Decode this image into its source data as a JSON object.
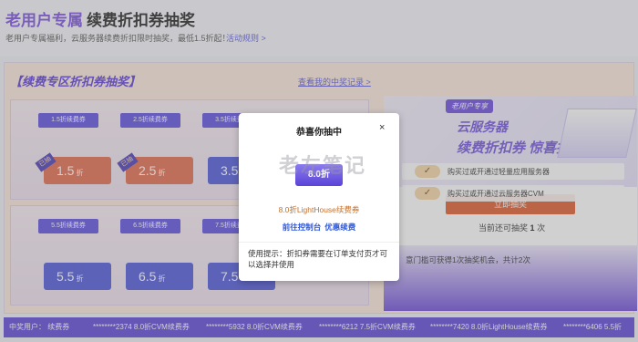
{
  "header": {
    "title_accent": "老用户专属",
    "title_main": "续费折扣券抽奖",
    "subtitle": "老用户专属福利，云服务器续费折扣限时抽奖，最低1.5折起！",
    "rules_link": "活动规则 >"
  },
  "left_panel": {
    "title": "【续费专区折扣券抽奖】",
    "records_link": "查看我的中奖记录 >",
    "row1_tags": [
      "1.5折续费券",
      "2.5折续费券",
      "3.5折续费券"
    ],
    "row1_tickets": [
      {
        "value": "1.5",
        "unit": "折",
        "ribbon": "已抽"
      },
      {
        "value": "2.5",
        "unit": "折",
        "ribbon": "已抽"
      },
      {
        "value": "3.5",
        "unit": "",
        "ribbon": ""
      }
    ],
    "row2_tags": [
      "5.5折续费券",
      "6.5折续费券",
      "7.5折续费券"
    ],
    "row2_tickets": [
      {
        "value": "5.5",
        "unit": "折"
      },
      {
        "value": "6.5",
        "unit": "折"
      },
      {
        "value": "7.5",
        "unit": ""
      }
    ]
  },
  "right_panel": {
    "tag": "老用户专享",
    "line1": "云服务器",
    "line2": "续费折扣券 惊喜抽",
    "draw_button": "立即抽奖",
    "times_prefix": "当前还可抽奖",
    "times_count": "1",
    "times_suffix": "次",
    "note": "意门槛可获得1次抽奖机会，共计2次",
    "tasks": [
      "购买过或开通过轻量应用服务器",
      "购买过或开通过云服务器CVM"
    ],
    "check_glyph": "✓"
  },
  "winners": {
    "label": "中奖用户：  续费券",
    "entries": [
      "********2374 8.0折CVM续费券",
      "********5932 8.0折CVM续费券",
      "********6212 7.5折CVM续费券",
      "********7420 8.0折LightHouse续费券",
      "********6406 5.5折"
    ]
  },
  "modal": {
    "title": "恭喜你抽中",
    "close": "×",
    "coupon_value": "8.0折",
    "watermark": "老左笔记",
    "prize": "8.0折LightHouse续费券",
    "link_console": "前往控制台",
    "link_renew": "优惠续费",
    "tip": "使用提示：折扣券需要在订单支付页才可以选择并使用"
  },
  "colors": {
    "accent": "#7a4de0",
    "primary_blue": "#5d45d8",
    "draw_orange": "#e05a2c",
    "prize_orange": "#c4702c",
    "link_blue": "#2b57e0"
  }
}
